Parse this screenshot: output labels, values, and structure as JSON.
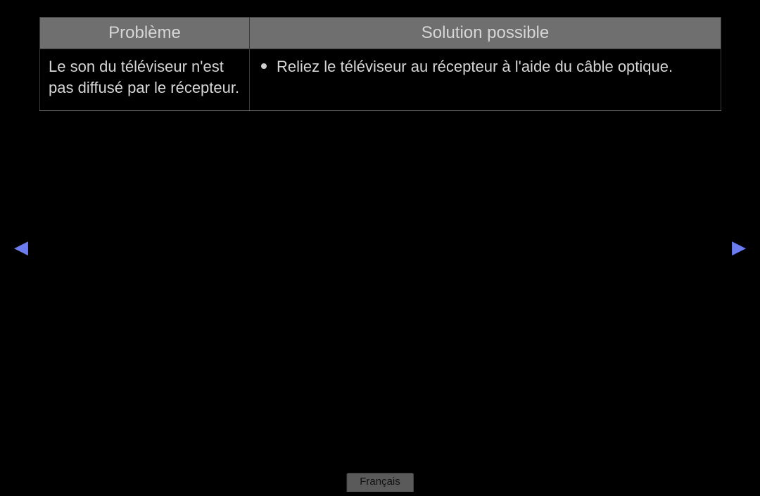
{
  "table": {
    "headers": {
      "problem": "Problème",
      "solution": "Solution possible"
    },
    "rows": [
      {
        "problem": "Le son du téléviseur n'est pas diffusé par le récepteur.",
        "solution": "Reliez le téléviseur au récepteur à l'aide du câble optique."
      }
    ]
  },
  "nav": {
    "prev_glyph": "◀",
    "next_glyph": "▶"
  },
  "language_badge": "Français"
}
